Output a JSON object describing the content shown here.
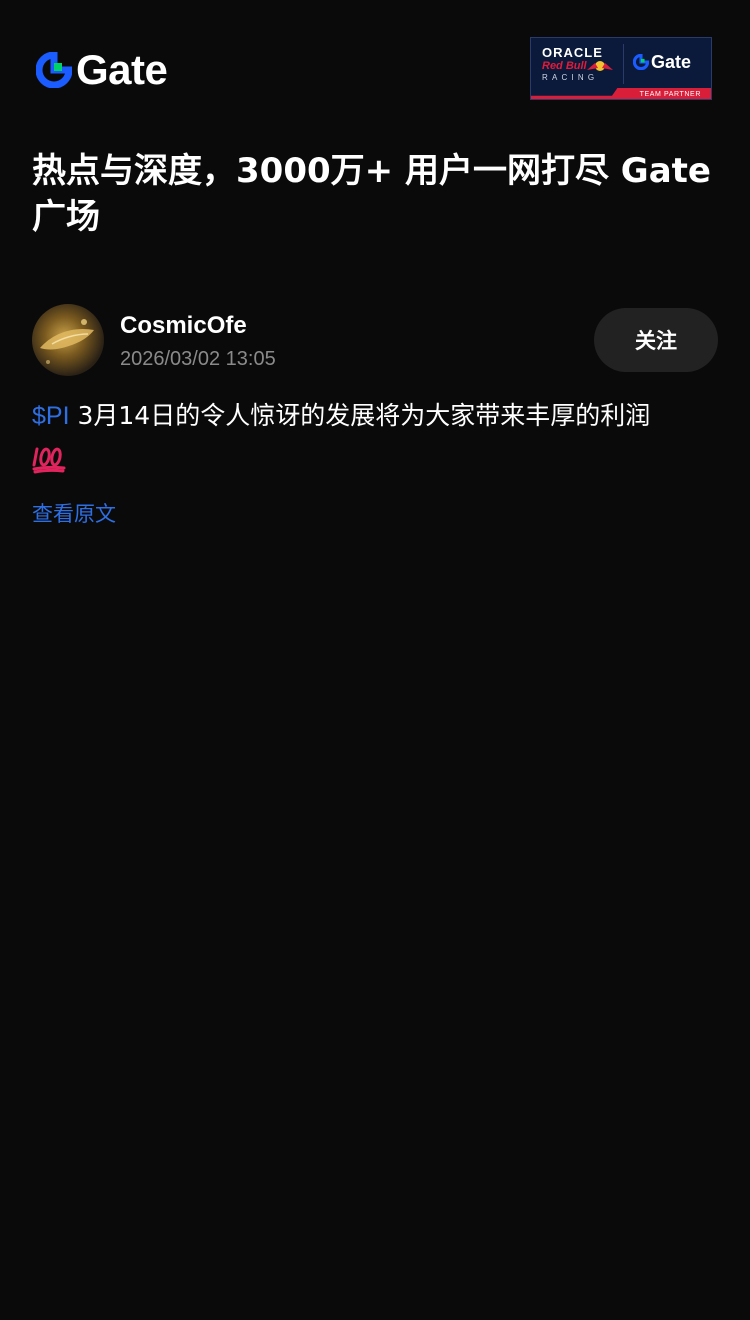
{
  "header": {
    "logo_text": "Gate",
    "logo_icon": "gate-logo-icon",
    "partner": {
      "oracle": "ORACLE",
      "redbull": "Red Bull",
      "racing": "RACING",
      "gate": "Gate",
      "team_partner": "TEAM PARTNER"
    }
  },
  "headline": "热点与深度，3000万+ 用户一网打尽 Gate 广场",
  "post": {
    "author": {
      "name": "CosmicOfe",
      "timestamp": "2026/03/02 13:05"
    },
    "follow_label": "关注",
    "ticker": "$PI",
    "text": " 3月14日的令人惊讶的发展将为大家带来丰厚的利润",
    "emoji": "hundred-points-icon",
    "view_original_label": "查看原文"
  },
  "colors": {
    "background": "#0a0a0a",
    "accent_blue": "#2f6fe4",
    "muted_text": "#8a8a8a",
    "button_bg": "#222222",
    "brand_green": "#00d26a",
    "brand_blue": "#1a5cff"
  }
}
